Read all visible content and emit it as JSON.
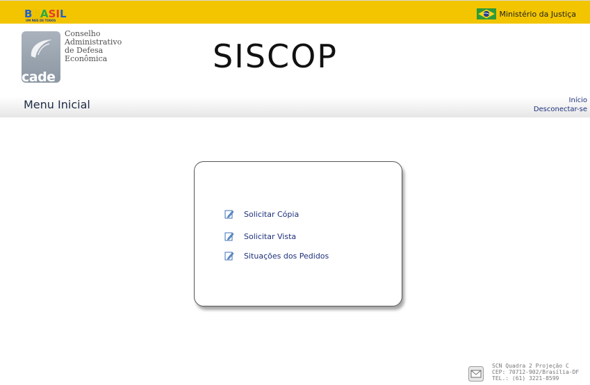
{
  "header": {
    "brand_logo_text": "BRASIL",
    "brand_tagline": "UM PAÍS DE TODOS",
    "ministry_label": "Ministério da Justiça"
  },
  "logo": {
    "org_lines": [
      "Conselho",
      "Administrativo",
      "de Defesa",
      "Econômica"
    ],
    "mark_text": "cade"
  },
  "app_title": "SISCOP",
  "menubar": {
    "title": "Menu Inicial",
    "links": [
      "Início",
      "Desconectar-se"
    ]
  },
  "menu": {
    "items": [
      {
        "label": "Solicitar Cópia",
        "icon": "edit-icon"
      },
      {
        "label": "Solicitar Vista",
        "icon": "edit-icon"
      },
      {
        "label": "Situações dos Pedidos",
        "icon": "edit-icon"
      }
    ]
  },
  "footer": {
    "address_lines": [
      "SCN Quadra 2 Projeção C",
      "CEP: 70712-902/Brasília-DF",
      "TEL.: (61) 3221-8599"
    ],
    "icon": "envelope-icon"
  },
  "colors": {
    "topbar": "#f2c500",
    "link": "#1c2f7a"
  }
}
